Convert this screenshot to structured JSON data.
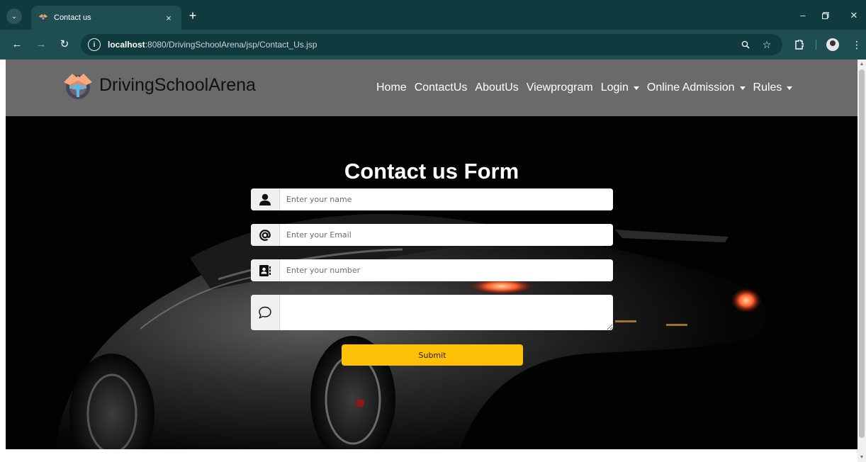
{
  "browser": {
    "tab_title": "Contact us",
    "tab_close": "×",
    "new_tab": "+",
    "url_host": "localhost",
    "url_path": ":8080/DrivingSchoolArena/jsp/Contact_Us.jsp",
    "icons": [
      "tab-search-icon",
      "favicon",
      "back-icon",
      "forward-icon",
      "reload-icon",
      "site-info-icon",
      "zoom-icon",
      "bookmark-star-icon",
      "extensions-icon",
      "profile-icon",
      "menu-icon",
      "minimize-icon",
      "restore-icon",
      "close-icon"
    ]
  },
  "navbar": {
    "brand": "DrivingSchoolArena",
    "links": [
      {
        "label": "Home",
        "dropdown": false
      },
      {
        "label": "ContactUs",
        "dropdown": false
      },
      {
        "label": "AboutUs",
        "dropdown": false
      },
      {
        "label": "Viewprogram",
        "dropdown": false
      },
      {
        "label": "Login",
        "dropdown": true
      },
      {
        "label": "Online Admission",
        "dropdown": true
      },
      {
        "label": "Rules",
        "dropdown": true
      }
    ]
  },
  "form": {
    "title": "Contact us Form",
    "name_placeholder": "Enter your name",
    "email_placeholder": "Enter your Email",
    "number_placeholder": "Enter your number",
    "message_placeholder": "",
    "submit_label": "Submit",
    "icons": [
      "user-icon",
      "at-icon",
      "contact-card-icon",
      "chat-bubble-icon"
    ]
  },
  "colors": {
    "browser_frame": "#0f3b3e",
    "browser_toolbar": "#1e4e52",
    "navbar_bg": "#6a6a6a",
    "submit_bg": "#ffc107",
    "hero_bg": "#020202"
  }
}
